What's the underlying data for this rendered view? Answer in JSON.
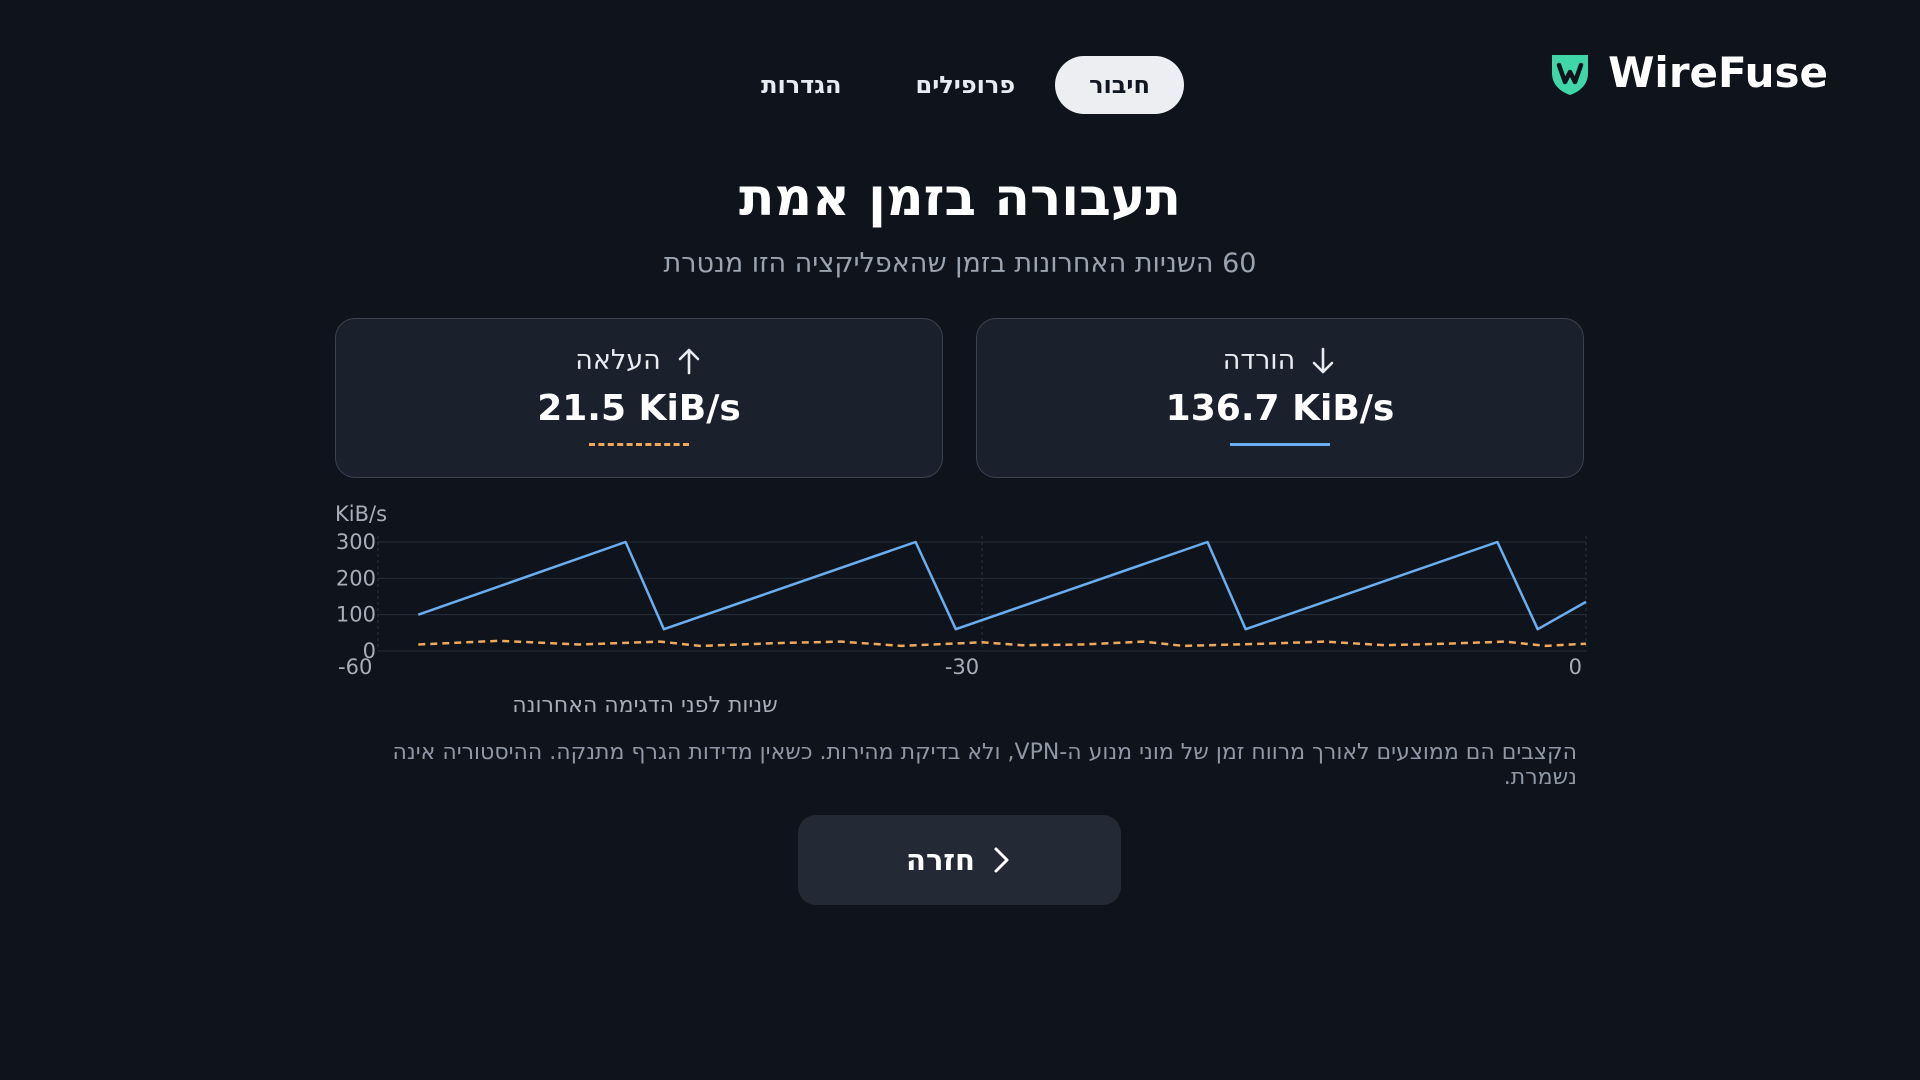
{
  "app": {
    "name": "WireFuse"
  },
  "tabs": [
    {
      "label": "חיבור",
      "active": true
    },
    {
      "label": "פרופילים",
      "active": false
    },
    {
      "label": "הגדרות",
      "active": false
    }
  ],
  "page": {
    "title": "תעבורה בזמן אמת",
    "subtitle": "60 השניות האחרונות בזמן שהאפליקציה הזו מנטרת"
  },
  "stats": {
    "download": {
      "label": "הורדה",
      "value": "136.7 KiB/s",
      "icon": "arrow-down-icon",
      "color": "#6aaef0"
    },
    "upload": {
      "label": "העלאה",
      "value": "21.5 KiB/s",
      "icon": "arrow-up-icon",
      "color": "#f0a85a"
    }
  },
  "chart_data": {
    "type": "line",
    "ylabel": "KiB/s",
    "xlabel": "שניות לפני הדגימה האחרונה",
    "ylim": [
      0,
      300
    ],
    "xlim": [
      -60,
      0
    ],
    "yticks": [
      "300",
      "200",
      "100",
      "0"
    ],
    "xticks": [
      "-60",
      "-30",
      "0"
    ],
    "grid": true,
    "series": [
      {
        "name": "הורדה",
        "style": "solid",
        "color": "#6aaef0",
        "points": [
          [
            -58,
            100
          ],
          [
            -47.7,
            300
          ],
          [
            -45.8,
            60
          ],
          [
            -33.3,
            300
          ],
          [
            -31.3,
            60
          ],
          [
            -18.8,
            300
          ],
          [
            -16.9,
            60
          ],
          [
            -4.4,
            300
          ],
          [
            -2.4,
            60
          ],
          [
            0,
            135
          ]
        ]
      },
      {
        "name": "העלאה",
        "style": "dashed",
        "color": "#f0a85a",
        "points": [
          [
            -58,
            18
          ],
          [
            -54,
            28
          ],
          [
            -50,
            18
          ],
          [
            -46,
            26
          ],
          [
            -44,
            14
          ],
          [
            -40,
            22
          ],
          [
            -37,
            26
          ],
          [
            -34,
            14
          ],
          [
            -30,
            24
          ],
          [
            -28,
            16
          ],
          [
            -25,
            18
          ],
          [
            -22,
            26
          ],
          [
            -20,
            14
          ],
          [
            -16,
            20
          ],
          [
            -13,
            26
          ],
          [
            -10,
            16
          ],
          [
            -7,
            20
          ],
          [
            -4,
            26
          ],
          [
            -2,
            14
          ],
          [
            0,
            20
          ]
        ]
      }
    ]
  },
  "note": "הקצבים הם ממוצעים לאורך מרווח זמן של מוני מנוע ה-VPN, ולא בדיקת מהירות. כשאין מדידות הגרף מתנקה. ההיסטוריה אינה נשמרת.",
  "back_button": {
    "label": "חזרה",
    "icon": "chevron-right-icon"
  }
}
